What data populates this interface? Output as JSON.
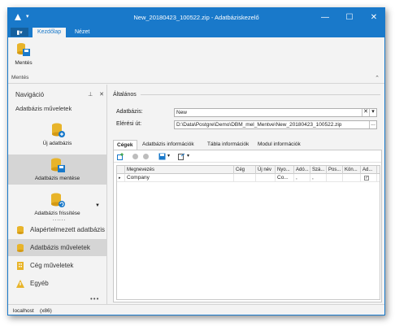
{
  "window": {
    "title": "New_20180423_100522.zip - Adatbáziskezelő"
  },
  "window_controls": {
    "minimize": "—",
    "maximize": "☐",
    "close": "✕"
  },
  "ribbon": {
    "file_label": "▮▾",
    "tabs": [
      "Kezdőlap",
      "Nézet"
    ],
    "save_label": "Mentés",
    "group_label": "Mentés",
    "collapse": "⌃"
  },
  "nav": {
    "title": "Navigáció",
    "pin": "⊥",
    "close": "✕",
    "subtitle": "Adatbázis műveletek",
    "actions": [
      {
        "label": "Új adatbázis"
      },
      {
        "label": "Adatbázis mentése"
      },
      {
        "label": "Adatbázis frissítése"
      }
    ],
    "more_dots": "......",
    "dropdown": "▼",
    "sections": [
      {
        "label": "Alapértelmezett adatbázis"
      },
      {
        "label": "Adatbázis műveletek"
      },
      {
        "label": "Cég műveletek"
      },
      {
        "label": "Egyéb"
      }
    ],
    "footer": "•••"
  },
  "general": {
    "group_title": "Általános",
    "db_label": "Adatbázis:",
    "db_value": "New",
    "path_label": "Elérési út:",
    "path_value": "D:\\Data\\Postgre\\Demo\\DBM_mel_Mentve\\New_20180423_100522.zip",
    "browse": "..."
  },
  "tabs": [
    "Cégek",
    "Adatbázis információk",
    "Tábla információk",
    "Modul információk"
  ],
  "grid": {
    "columns": [
      "Megnevezés",
      "Cég",
      "Új név",
      "Nyo...",
      "Adó...",
      "Szá...",
      "Pos...",
      "Kön...",
      "Ad..."
    ],
    "rows": [
      {
        "indicator": "▸",
        "cells": [
          "Company",
          "",
          "",
          "Co...",
          ",",
          ",",
          "",
          "",
          "✓"
        ]
      }
    ]
  },
  "status": {
    "server": "localhost",
    "arch": "(x86)"
  },
  "colors": {
    "accent": "#1979ca",
    "ribbon_bg": "#f3f3f3",
    "selected": "#d5d5d5"
  }
}
